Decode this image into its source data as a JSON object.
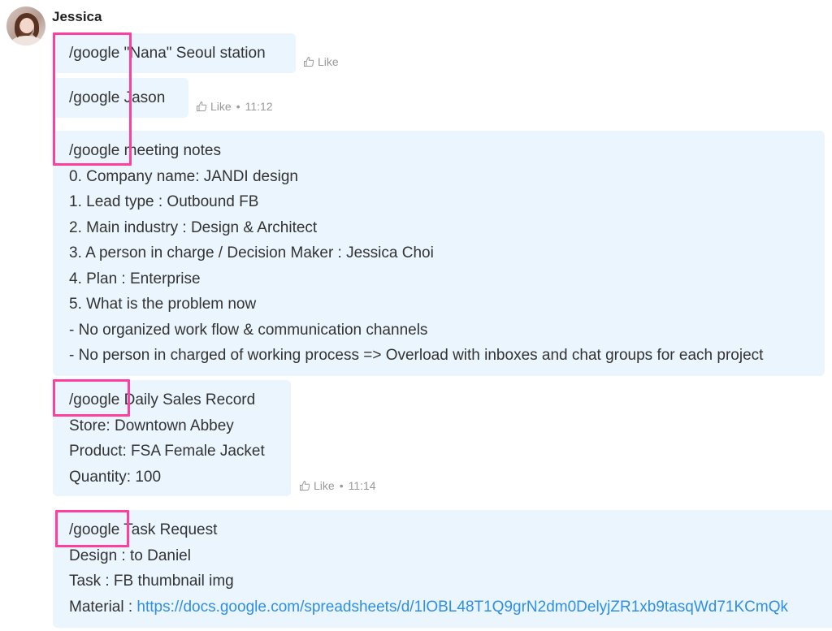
{
  "sender": {
    "name": "Jessica"
  },
  "actions": {
    "like_label": "Like",
    "separator": "•"
  },
  "messages": [
    {
      "lines": [
        "/google \"Nana\" Seoul station"
      ],
      "time": ""
    },
    {
      "lines": [
        "/google Jason"
      ],
      "time": "11:12"
    },
    {
      "lines": [
        "/google meeting notes",
        "0. Company name: JANDI design",
        "1. Lead type :  Outbound FB",
        "2. Main industry : Design & Architect",
        "3. A person in charge / Decision Maker : Jessica Choi",
        "4. Plan : Enterprise",
        "5. What is the problem now",
        "- No organized work flow & communication channels",
        "- No person in charged of working process => Overload with inboxes and chat groups for each project"
      ]
    },
    {
      "lines": [
        "/google Daily Sales Record",
        "Store: Downtown Abbey",
        "Product: FSA Female Jacket",
        "Quantity: 100"
      ],
      "time": "11:14"
    },
    {
      "lines": [
        "/google Task Request",
        "Design : to Daniel",
        "Task : FB thumbnail img"
      ],
      "material_label": "Material : ",
      "material_link": "https://docs.google.com/spreadsheets/d/1lOBL48T1Q9grN2dm0DelyjZR1xb9tasqWd71KCmQk"
    }
  ],
  "colors": {
    "bubble_bg": "#eaf5fe",
    "highlight": "#ff3fa0",
    "link": "#2f8ee6",
    "meta_text": "#999999"
  }
}
